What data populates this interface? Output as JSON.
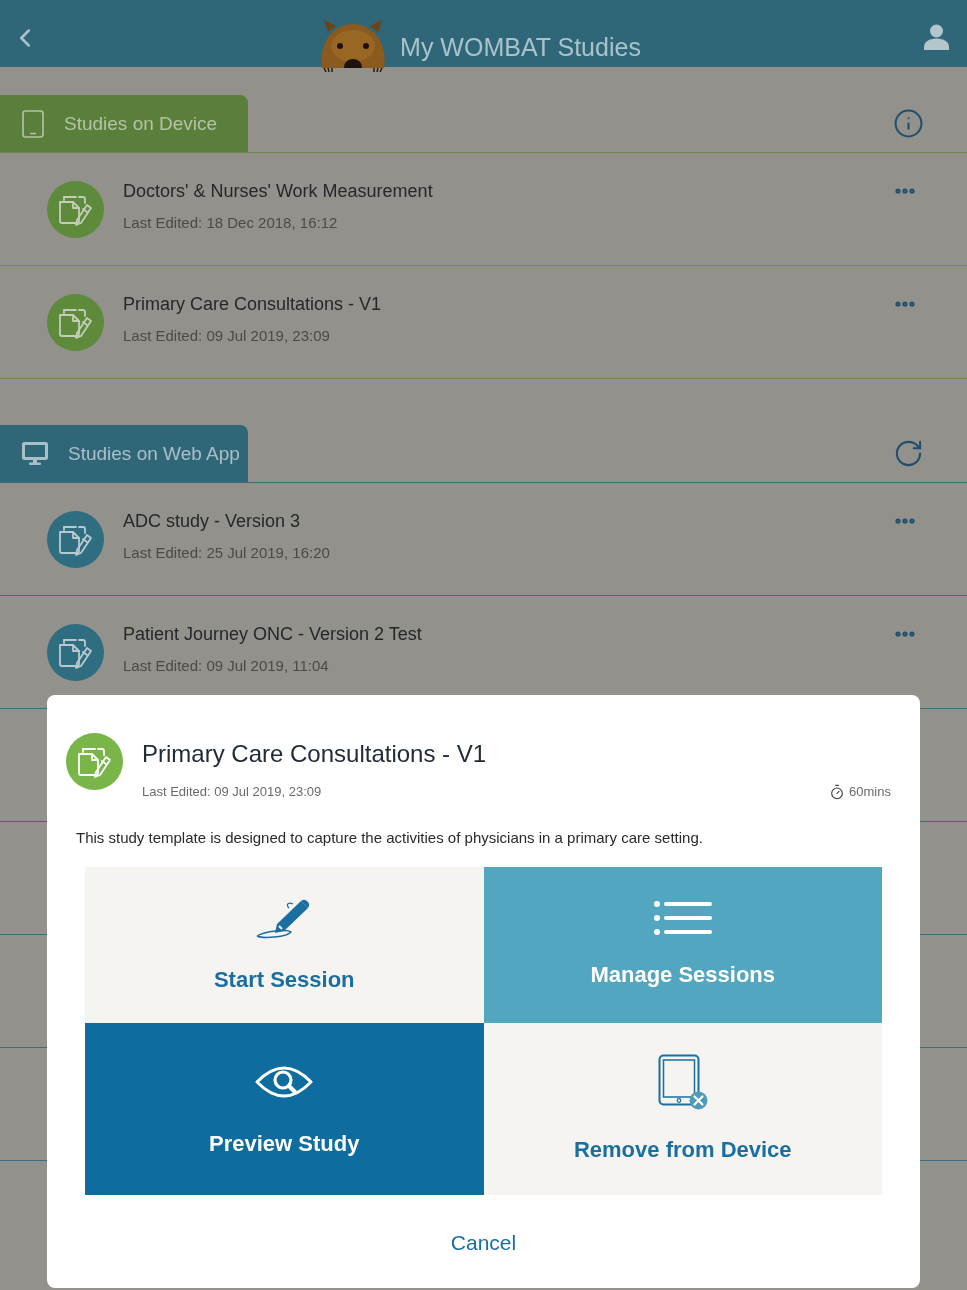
{
  "header": {
    "title": "My WOMBAT Studies"
  },
  "sections": [
    {
      "kind": "device",
      "title": "Studies on Device",
      "studies": [
        {
          "title": "Doctors' & Nurses' Work Measurement",
          "last_edited": "Last Edited: 18 Dec 2018, 16:12"
        },
        {
          "title": "Primary Care Consultations - V1",
          "last_edited": "Last Edited: 09 Jul 2019, 23:09"
        }
      ]
    },
    {
      "kind": "web",
      "title": "Studies on Web App",
      "studies": [
        {
          "title": "ADC study - Version 3",
          "last_edited": "Last Edited: 25 Jul 2019, 16:20"
        },
        {
          "title": "Patient Journey ONC - Version 2 Test",
          "last_edited": "Last Edited: 09 Jul 2019, 11:04"
        }
      ]
    }
  ],
  "dialog": {
    "title": "Primary Care Consultations - V1",
    "last_edited": "Last Edited: 09 Jul 2019, 23:09",
    "duration": "60mins",
    "description": "This study template is designed to capture the activities of physicians in a primary care setting.",
    "actions": [
      {
        "kind": "start",
        "label": "Start Session"
      },
      {
        "kind": "manage",
        "label": "Manage Sessions"
      },
      {
        "kind": "preview",
        "label": "Preview Study"
      },
      {
        "kind": "remove",
        "label": "Remove from Device"
      }
    ],
    "cancel": "Cancel"
  }
}
